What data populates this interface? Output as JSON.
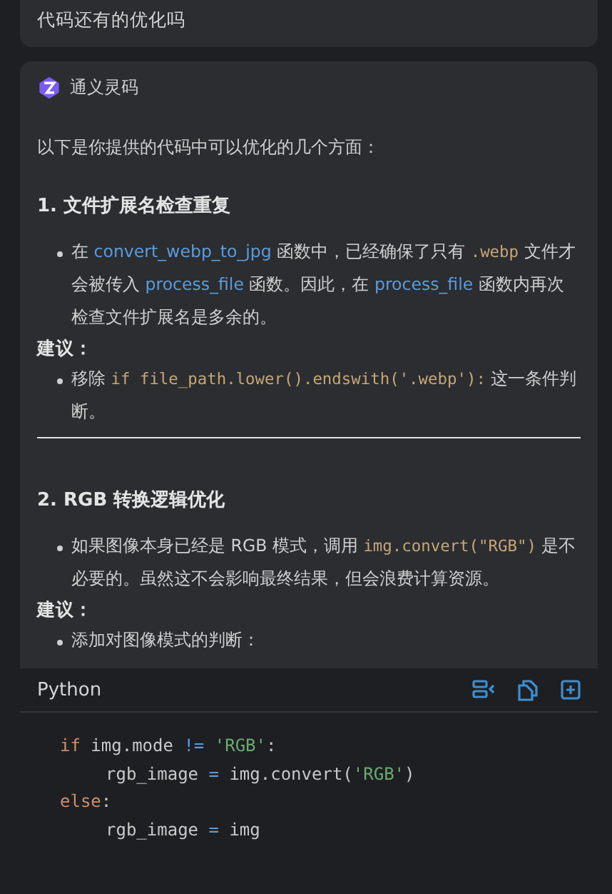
{
  "user_message": {
    "text": "代码还有的优化吗"
  },
  "assistant": {
    "name": "通义灵码",
    "blocks": [
      {
        "kind": "paragraph",
        "segments": [
          {
            "kind": "text",
            "text": "以下是你提供的代码中可以优化的几个方面："
          }
        ]
      },
      {
        "kind": "heading",
        "text": "1. 文件扩展名检查重复"
      },
      {
        "kind": "bullet",
        "segments": [
          {
            "kind": "text",
            "text": "在 "
          },
          {
            "kind": "link",
            "text": "convert_webp_to_jpg"
          },
          {
            "kind": "text",
            "text": " 函数中，已经确保了只有 "
          },
          {
            "kind": "code",
            "text": ".webp"
          },
          {
            "kind": "text",
            "text": " 文件才会被传入 "
          },
          {
            "kind": "link",
            "text": "process_file"
          },
          {
            "kind": "text",
            "text": " 函数。因此，在 "
          },
          {
            "kind": "link",
            "text": "process_file"
          },
          {
            "kind": "text",
            "text": " 函数内再次检查文件扩展名是多余的。"
          }
        ]
      },
      {
        "kind": "label",
        "text": "建议："
      },
      {
        "kind": "bullet",
        "segments": [
          {
            "kind": "text",
            "text": "移除 "
          },
          {
            "kind": "code",
            "text": "if file_path.lower().endswith('.webp'):"
          },
          {
            "kind": "text",
            "text": " 这一条件判断。"
          }
        ]
      },
      {
        "kind": "rule"
      },
      {
        "kind": "heading",
        "text": "2. RGB 转换逻辑优化"
      },
      {
        "kind": "bullet",
        "segments": [
          {
            "kind": "text",
            "text": "如果图像本身已经是 RGB 模式，调用 "
          },
          {
            "kind": "code",
            "text": "img.convert(\"RGB\")"
          },
          {
            "kind": "text",
            "text": " 是不必要的。虽然这不会影响最终结果，但会浪费计算资源。"
          }
        ]
      },
      {
        "kind": "label",
        "text": "建议："
      },
      {
        "kind": "bullet",
        "segments": [
          {
            "kind": "text",
            "text": "添加对图像模式的判断："
          }
        ]
      }
    ],
    "code_block": {
      "language": "Python",
      "lines": [
        {
          "indent": false,
          "tokens": [
            {
              "kind": "keyword",
              "text": "if"
            },
            {
              "kind": "plain",
              "text": " img.mode "
            },
            {
              "kind": "operator",
              "text": "!="
            },
            {
              "kind": "string",
              "text": " 'RGB'"
            },
            {
              "kind": "plain",
              "text": ":"
            }
          ]
        },
        {
          "indent": true,
          "tokens": [
            {
              "kind": "plain",
              "text": "rgb_image "
            },
            {
              "kind": "operator",
              "text": "="
            },
            {
              "kind": "plain",
              "text": " img.convert("
            },
            {
              "kind": "string",
              "text": "'RGB'"
            },
            {
              "kind": "plain",
              "text": ")"
            }
          ]
        },
        {
          "indent": false,
          "tokens": [
            {
              "kind": "keyword",
              "text": "else"
            },
            {
              "kind": "plain",
              "text": ":"
            }
          ]
        },
        {
          "indent": true,
          "tokens": [
            {
              "kind": "plain",
              "text": "rgb_image "
            },
            {
              "kind": "operator",
              "text": "="
            },
            {
              "kind": "plain",
              "text": " img"
            }
          ]
        }
      ]
    }
  }
}
